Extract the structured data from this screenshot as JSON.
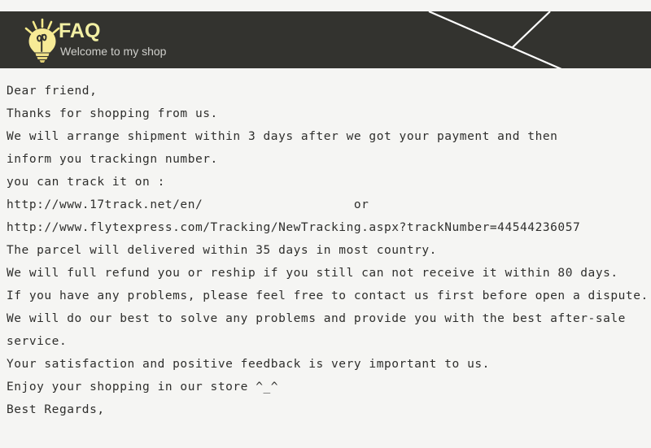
{
  "header": {
    "title": "FAQ",
    "subtitle": "Welcome to my shop",
    "icon": "lightbulb-icon",
    "band_color": "#33332f",
    "title_color": "#f2efa4",
    "subtitle_color": "#cfcfcb",
    "decoration": "diagonal-chevron-lines"
  },
  "page": {
    "background_color": "#f5f5f3",
    "text_color": "#2e2e2c"
  },
  "body": {
    "lines": [
      "Dear friend,",
      "Thanks for shopping from us.",
      "We will arrange shipment within 3 days after we got your payment and then",
      "inform you trackingn number.",
      "you can track it on :",
      "http://www.17track.net/en/                    or",
      "http://www.flytexpress.com/Tracking/NewTracking.aspx?trackNumber=44544236057",
      "The parcel will delivered within 35 days in most country.",
      "We will full refund you or reship if you still can not receive it within 80 days.",
      "If you have any problems, please feel free to contact us first before open a dispute.",
      "We will do our best to solve any problems and provide you with the best after-sale",
      "service.",
      "Your satisfaction and positive feedback is very important to us.",
      "Enjoy your shopping in our store ^_^",
      "Best Regards,"
    ],
    "tracking_url_1": "http://www.17track.net/en/",
    "tracking_url_2": "http://www.flytexpress.com/Tracking/NewTracking.aspx?trackNumber=44544236057",
    "tracking_number": "44544236057",
    "shipping_days": "3",
    "delivery_days": "35",
    "refund_days": "80",
    "or_label": "or",
    "emoticon": "^_^"
  }
}
